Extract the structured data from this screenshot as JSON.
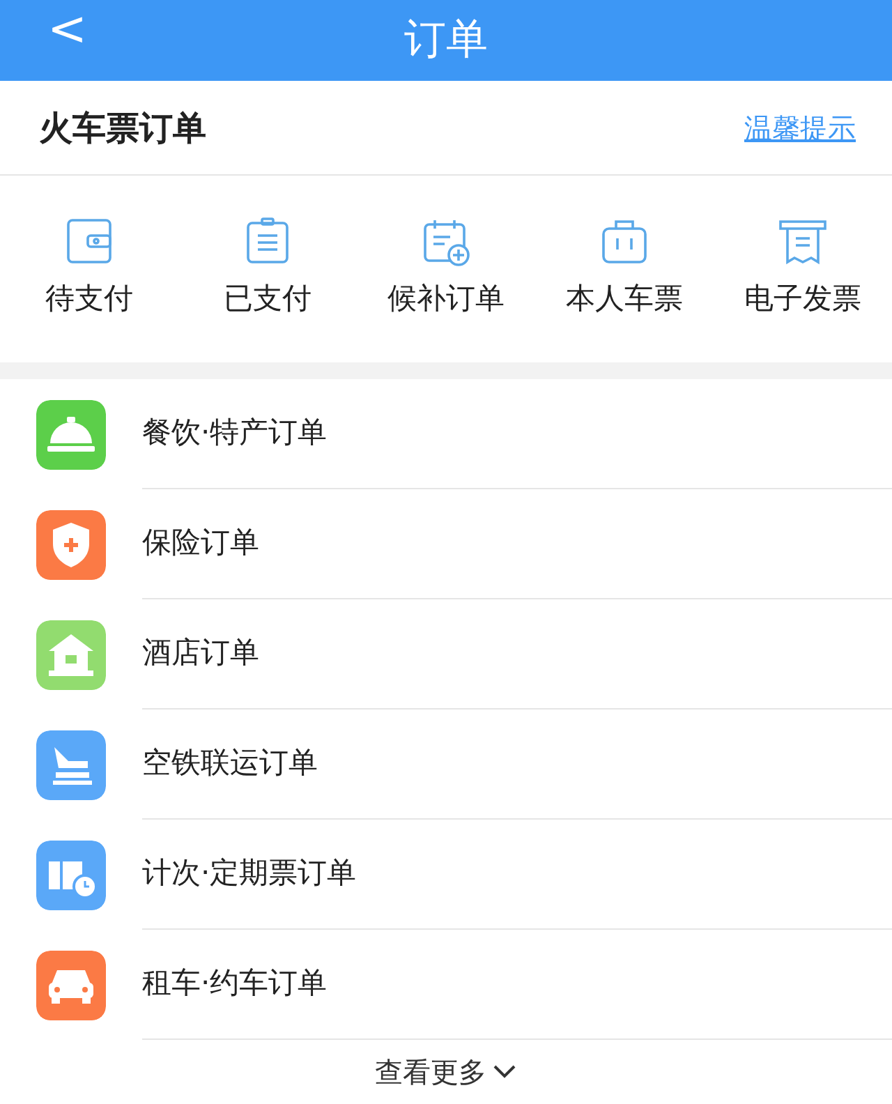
{
  "header": {
    "back": "<",
    "title": "订单"
  },
  "section": {
    "title": "火车票订单",
    "tip_link": "温馨提示"
  },
  "shortcuts": [
    {
      "kind": "wallet",
      "label": "待支付"
    },
    {
      "kind": "clipboard",
      "label": "已支付"
    },
    {
      "kind": "calendar",
      "label": "候补订单"
    },
    {
      "kind": "suitcase",
      "label": "本人车票"
    },
    {
      "kind": "receipt",
      "label": "电子发票"
    }
  ],
  "orders": [
    {
      "kind": "bell",
      "color": "#5ccf4a",
      "label": "餐饮·特产订单"
    },
    {
      "kind": "shield",
      "color": "#fb7a45",
      "label": "保险订单"
    },
    {
      "kind": "house",
      "color": "#92dc6f",
      "label": "酒店订单"
    },
    {
      "kind": "plane",
      "color": "#5aa8f8",
      "label": "空铁联运订单"
    },
    {
      "kind": "ticket",
      "color": "#5aa8f8",
      "label": "计次·定期票订单"
    },
    {
      "kind": "car",
      "color": "#fb7a45",
      "label": "租车·约车订单"
    }
  ],
  "more": {
    "label": "查看更多"
  }
}
